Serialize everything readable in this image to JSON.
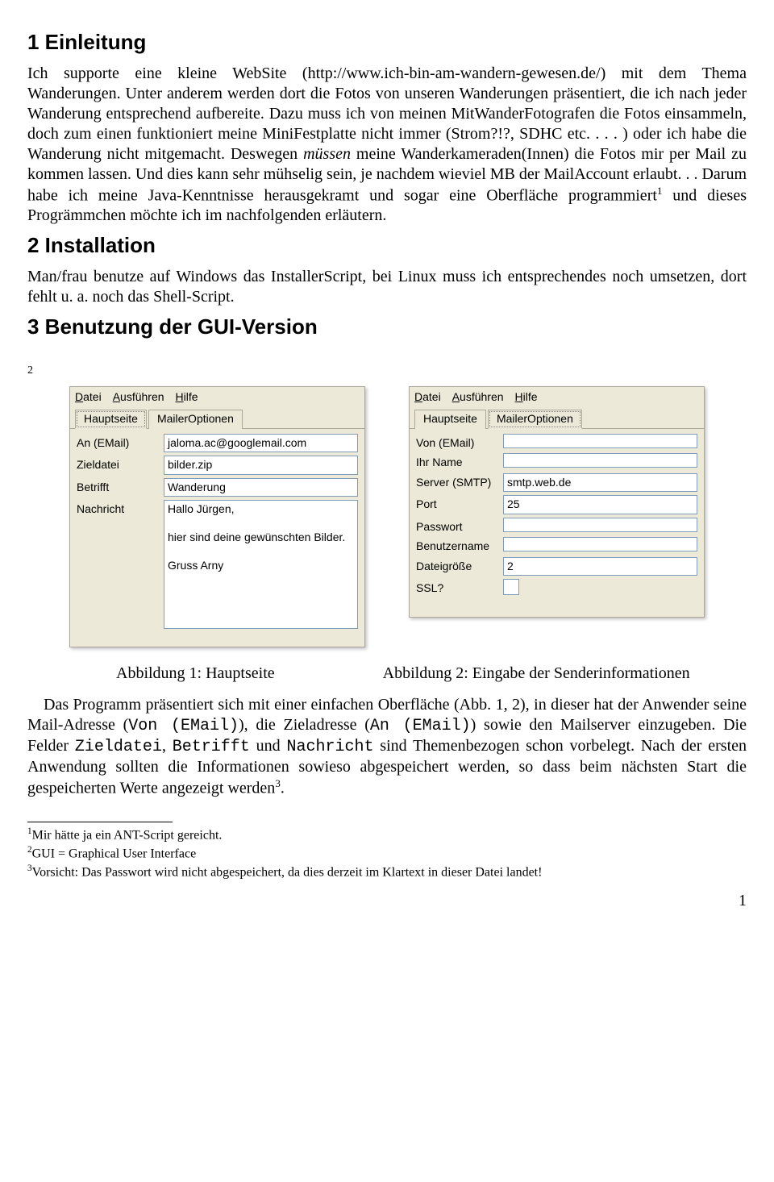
{
  "sections": {
    "s1": {
      "title": "1 Einleitung"
    },
    "s2": {
      "title": "2 Installation"
    },
    "s3": {
      "title": "3 Benutzung der GUI-Version"
    }
  },
  "para1a": "Ich supporte eine kleine WebSite (http://www.ich-bin-am-wandern-gewesen.de/) mit dem Thema Wanderungen. Unter anderem werden dort die Fotos von unseren Wanderungen präsentiert, die ich nach jeder Wanderung entsprechend aufbereite. Dazu muss ich von meinen MitWanderFotografen die Fotos einsammeln, doch zum einen funktioniert meine MiniFestplatte nicht immer (Strom?!?, SDHC etc. . . . ) oder ich habe die Wanderung nicht mitgemacht. Deswegen ",
  "para1b": " meine Wanderkameraden(Innen) die Fotos mir per Mail zu kommen lassen. Und dies kann sehr mühselig sein, je nachdem wieviel MB der MailAccount erlaubt. . . Darum habe ich meine Java-Kenntnisse herausgekramt und sogar eine Oberfläche programmiert",
  "para1c": " und dieses Progrämmchen möchte ich im nachfolgenden erläutern.",
  "para1_ital": "müssen",
  "fn1_ref": "1",
  "para2": "Man/frau benutze auf Windows das InstallerScript, bei Linux muss ich entsprechendes noch umsetzen, dort fehlt u. a. noch das Shell-Script.",
  "s3_marker": "2",
  "app": {
    "menu": {
      "datei_pre": "D",
      "datei_rest": "atei",
      "aus_pre": "A",
      "aus_rest": "usführen",
      "hilfe_pre": "H",
      "hilfe_rest": "ilfe"
    },
    "tabs": {
      "haupt": "Hauptseite",
      "mailer": "MailerOptionen"
    },
    "left": {
      "an": {
        "label": "An (EMail)",
        "value": "jaloma.ac@googlemail.com"
      },
      "ziel": {
        "label": "Zieldatei",
        "value": "bilder.zip"
      },
      "betr": {
        "label": "Betrifft",
        "value": "Wanderung"
      },
      "nachr": {
        "label": "Nachricht",
        "value": "Hallo Jürgen,\n\nhier sind deine gewünschten Bilder.\n\nGruss Arny"
      }
    },
    "right": {
      "von": {
        "label": "Von (EMail)",
        "value": ""
      },
      "name": {
        "label": "Ihr Name",
        "value": ""
      },
      "smtp": {
        "label": "Server (SMTP)",
        "value": "smtp.web.de"
      },
      "port": {
        "label": "Port",
        "value": "25"
      },
      "pw": {
        "label": "Passwort",
        "value": ""
      },
      "user": {
        "label": "Benutzername",
        "value": ""
      },
      "size": {
        "label": "Dateigröße",
        "value": "2"
      },
      "ssl": {
        "label": "SSL?",
        "value": ""
      }
    }
  },
  "captions": {
    "c1": "Abbildung 1: Hauptseite",
    "c2": "Abbildung 2: Eingabe der Senderinformationen"
  },
  "para3a": "Das Programm präsentiert sich mit einer einfachen Oberfläche (Abb. 1, 2), in dieser hat der Anwender seine Mail-Adresse (",
  "para3b": "), die Zieladresse (",
  "para3c": " sowie den Mailserver einzugeben. Die Felder ",
  "para3d": " und ",
  "para3e": " sind Themenbezogen schon vorbelegt. Nach der ersten Anwendung sollten die Informationen sowieso abgespeichert werden, so dass beim nächsten Start die gespeicherten Werte angezeigt werden",
  "para3f": ".",
  "mono": {
    "von": "Von (EMail)",
    "an": "An (EMail)",
    "ziel": "Zieldatei",
    "betr": "Betrifft",
    "nachr": "Nachricht"
  },
  "fn3_ref": "3",
  "footnotes": {
    "f1n": "1",
    "f1": "Mir hätte ja ein ANT-Script gereicht.",
    "f2n": "2",
    "f2": "GUI = Graphical User Interface",
    "f3n": "3",
    "f3": "Vorsicht: Das Passwort wird nicht abgespeichert, da dies derzeit im Klartext in dieser Datei landet!"
  },
  "pageno": "1"
}
